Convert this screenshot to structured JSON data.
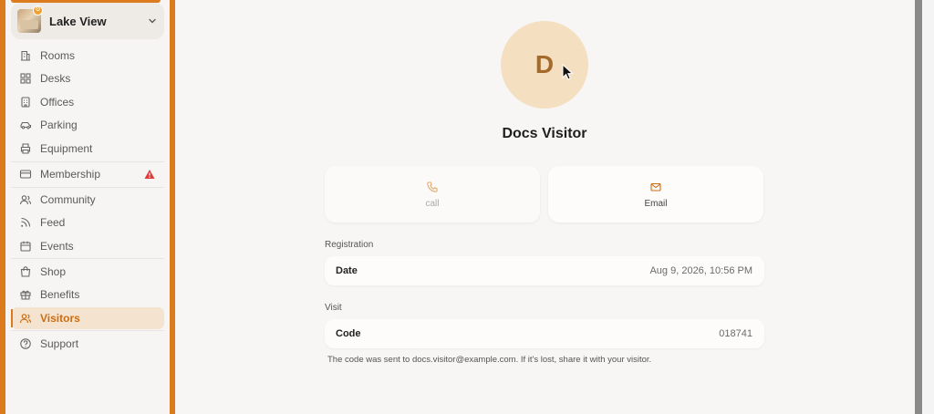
{
  "sidebar": {
    "location_name": "Lake View",
    "items": [
      {
        "label": "Rooms",
        "icon": "building-icon"
      },
      {
        "label": "Desks",
        "icon": "grid-icon"
      },
      {
        "label": "Offices",
        "icon": "office-icon"
      },
      {
        "label": "Parking",
        "icon": "car-icon"
      },
      {
        "label": "Equipment",
        "icon": "printer-icon"
      },
      {
        "label": "Membership",
        "icon": "card-icon",
        "alert": true
      },
      {
        "label": "Community",
        "icon": "people-icon"
      },
      {
        "label": "Feed",
        "icon": "rss-icon"
      },
      {
        "label": "Events",
        "icon": "calendar-icon"
      },
      {
        "label": "Shop",
        "icon": "bag-icon"
      },
      {
        "label": "Benefits",
        "icon": "gift-icon"
      },
      {
        "label": "Visitors",
        "icon": "visitors-icon",
        "active": true
      },
      {
        "label": "Support",
        "icon": "help-icon"
      }
    ]
  },
  "visitor": {
    "initial": "D",
    "name": "Docs Visitor"
  },
  "actions": {
    "call_label": "call",
    "email_label": "Email"
  },
  "registration": {
    "section_label": "Registration",
    "key": "Date",
    "value": "Aug 9, 2026, 10:56 PM"
  },
  "visit": {
    "section_label": "Visit",
    "key": "Code",
    "value": "018741",
    "note": "The code was sent to docs.visitor@example.com. If it's lost, share it with your visitor."
  },
  "colors": {
    "accent": "#dc7b1e",
    "active_bg": "#f4e3cf",
    "avatar_bg": "#f4dfc1",
    "warning": "#e03b3b"
  }
}
